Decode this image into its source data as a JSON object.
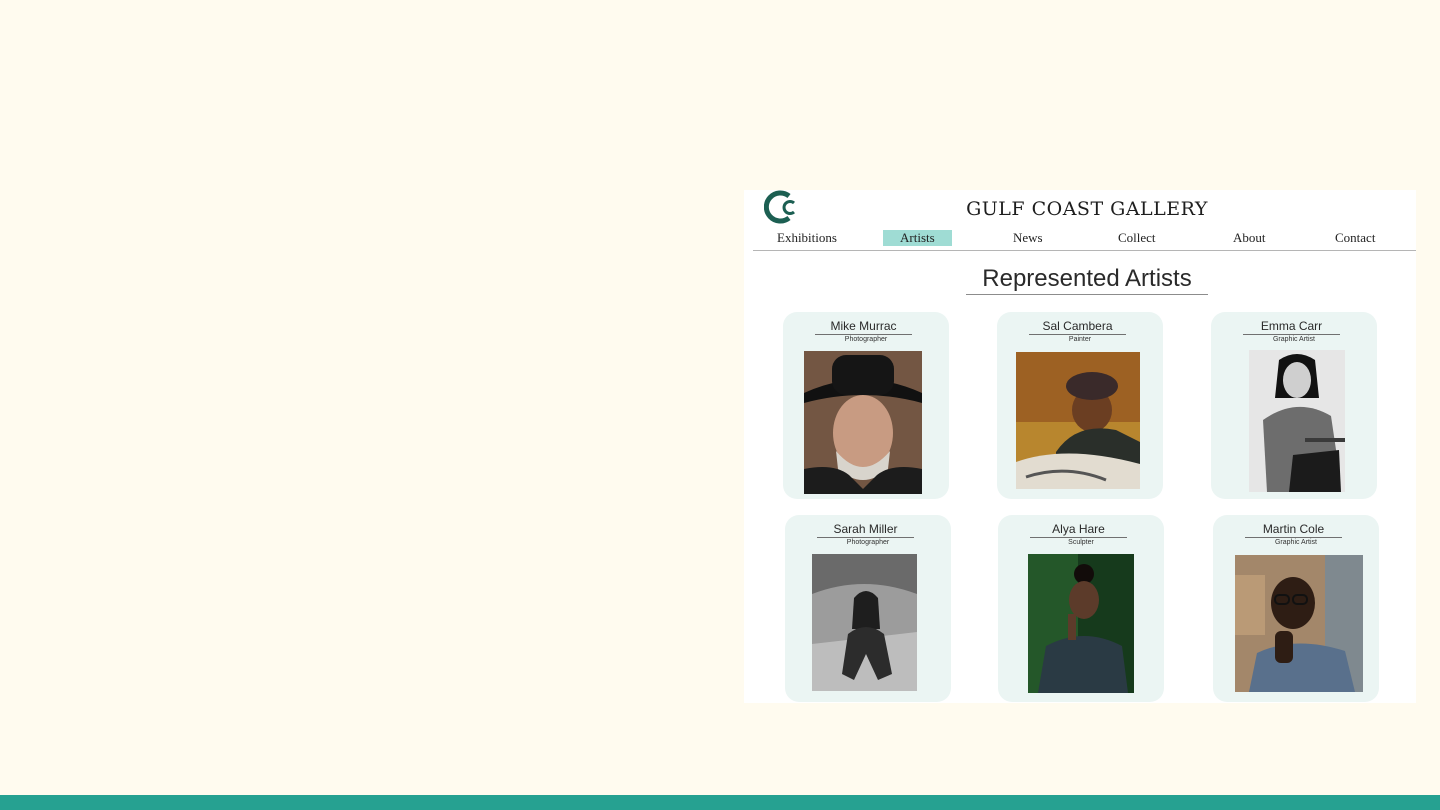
{
  "site": {
    "title": "GULF COAST GALLERY",
    "logo_icon": "gulf-coast-gallery-logo",
    "logo_color": "#1c5f52"
  },
  "nav": {
    "items": [
      {
        "label": "Exhibitions",
        "active": false
      },
      {
        "label": "Artists",
        "active": true
      },
      {
        "label": "News",
        "active": false
      },
      {
        "label": "Collect",
        "active": false
      },
      {
        "label": "About",
        "active": false
      },
      {
        "label": "Contact",
        "active": false
      }
    ],
    "active_color": "#9fdcd4"
  },
  "page": {
    "heading": "Represented Artists"
  },
  "artists": [
    {
      "name": "Mike Murrac",
      "role": "Photographer",
      "photo": "portrait-man-cowboy-hat"
    },
    {
      "name": "Sal Cambera",
      "role": "Painter",
      "photo": "portrait-painter-at-work"
    },
    {
      "name": "Emma Carr",
      "role": "Graphic Artist",
      "photo": "portrait-woman-black-and-white"
    },
    {
      "name": "Sarah Miller",
      "role": "Photographer",
      "photo": "portrait-woman-crouching-black-and-white"
    },
    {
      "name": "Alya Hare",
      "role": "Sculpter",
      "photo": "portrait-woman-green-background"
    },
    {
      "name": "Martin Cole",
      "role": "Graphic Artist",
      "photo": "portrait-man-glasses"
    }
  ],
  "colors": {
    "page_background": "#fffbef",
    "accent_bar": "#26a191",
    "card_background": "#ebf5f3"
  }
}
